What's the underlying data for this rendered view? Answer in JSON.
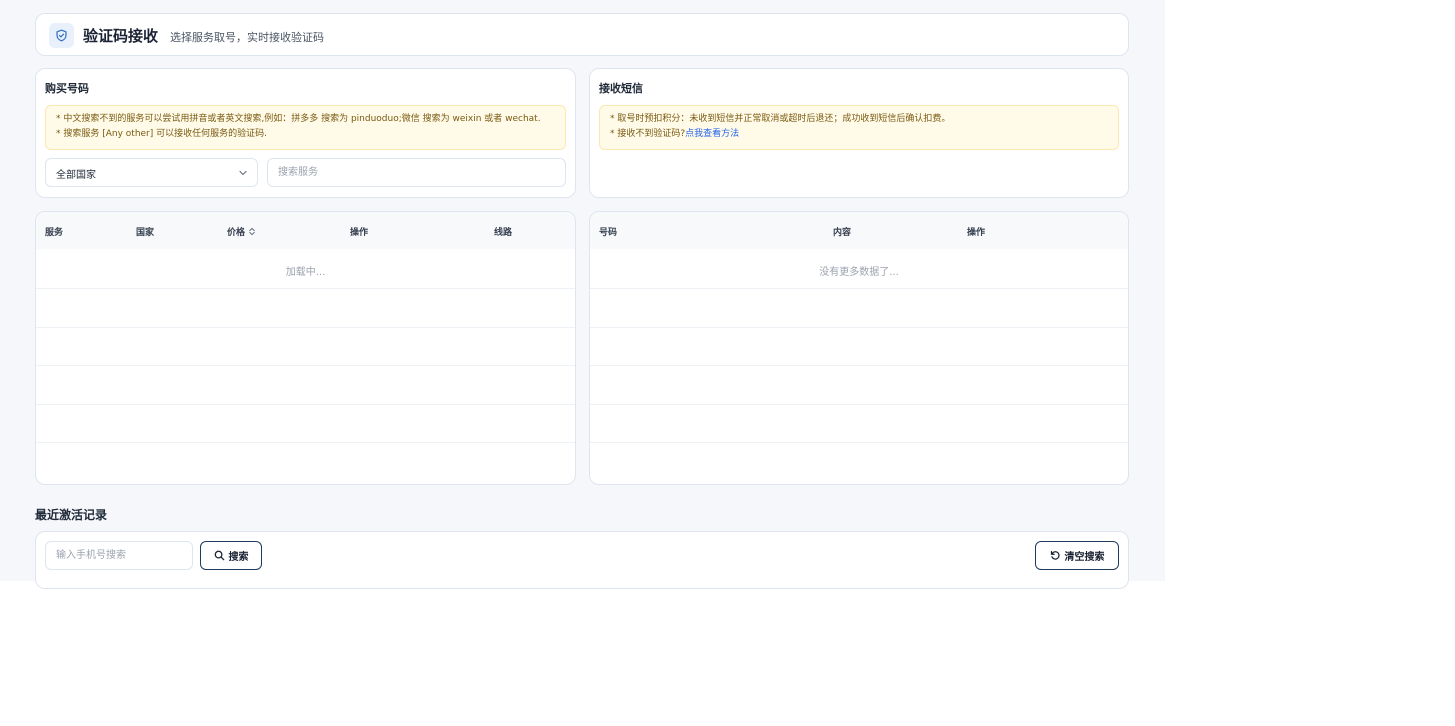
{
  "header": {
    "title": "验证码接收",
    "subtitle": "选择服务取号，实时接收验证码"
  },
  "buy": {
    "title": "购买号码",
    "notice_line1": "* 中文搜索不到的服务可以尝试用拼音或者英文搜索,例如：拼多多 搜索为 pinduoduo;微信 搜索为 weixin 或者 wechat.",
    "notice_line2": "* 搜索服务 [Any other] 可以接收任何服务的验证码.",
    "country_select": "全部国家",
    "service_placeholder": "搜索服务"
  },
  "receive": {
    "title": "接收短信",
    "notice_line1": "* 取号时预扣积分：未收到短信并正常取消或超时后退还；成功收到短信后确认扣费。",
    "notice_line2_prefix": "* 接收不到验证码?",
    "notice_link": "点我查看方法"
  },
  "services_table": {
    "columns": [
      "服务",
      "国家",
      "价格",
      "操作",
      "线路"
    ],
    "status": "加载中..."
  },
  "sms_table": {
    "columns": [
      "号码",
      "内容",
      "操作"
    ],
    "status": "没有更多数据了..."
  },
  "recent": {
    "title": "最近激活记录",
    "phone_placeholder": "输入手机号搜索",
    "search_label": "搜索",
    "clear_label": "清空搜索"
  },
  "icons": {
    "logo": "shield-check-icon",
    "select_arrow": "chevron-down-icon",
    "sort": "sort-icon",
    "search": "search-icon",
    "clear": "refresh-icon"
  },
  "colors": {
    "accent": "#1e3a5f",
    "notice_bg": "#fffbe8",
    "link": "#2563eb"
  }
}
